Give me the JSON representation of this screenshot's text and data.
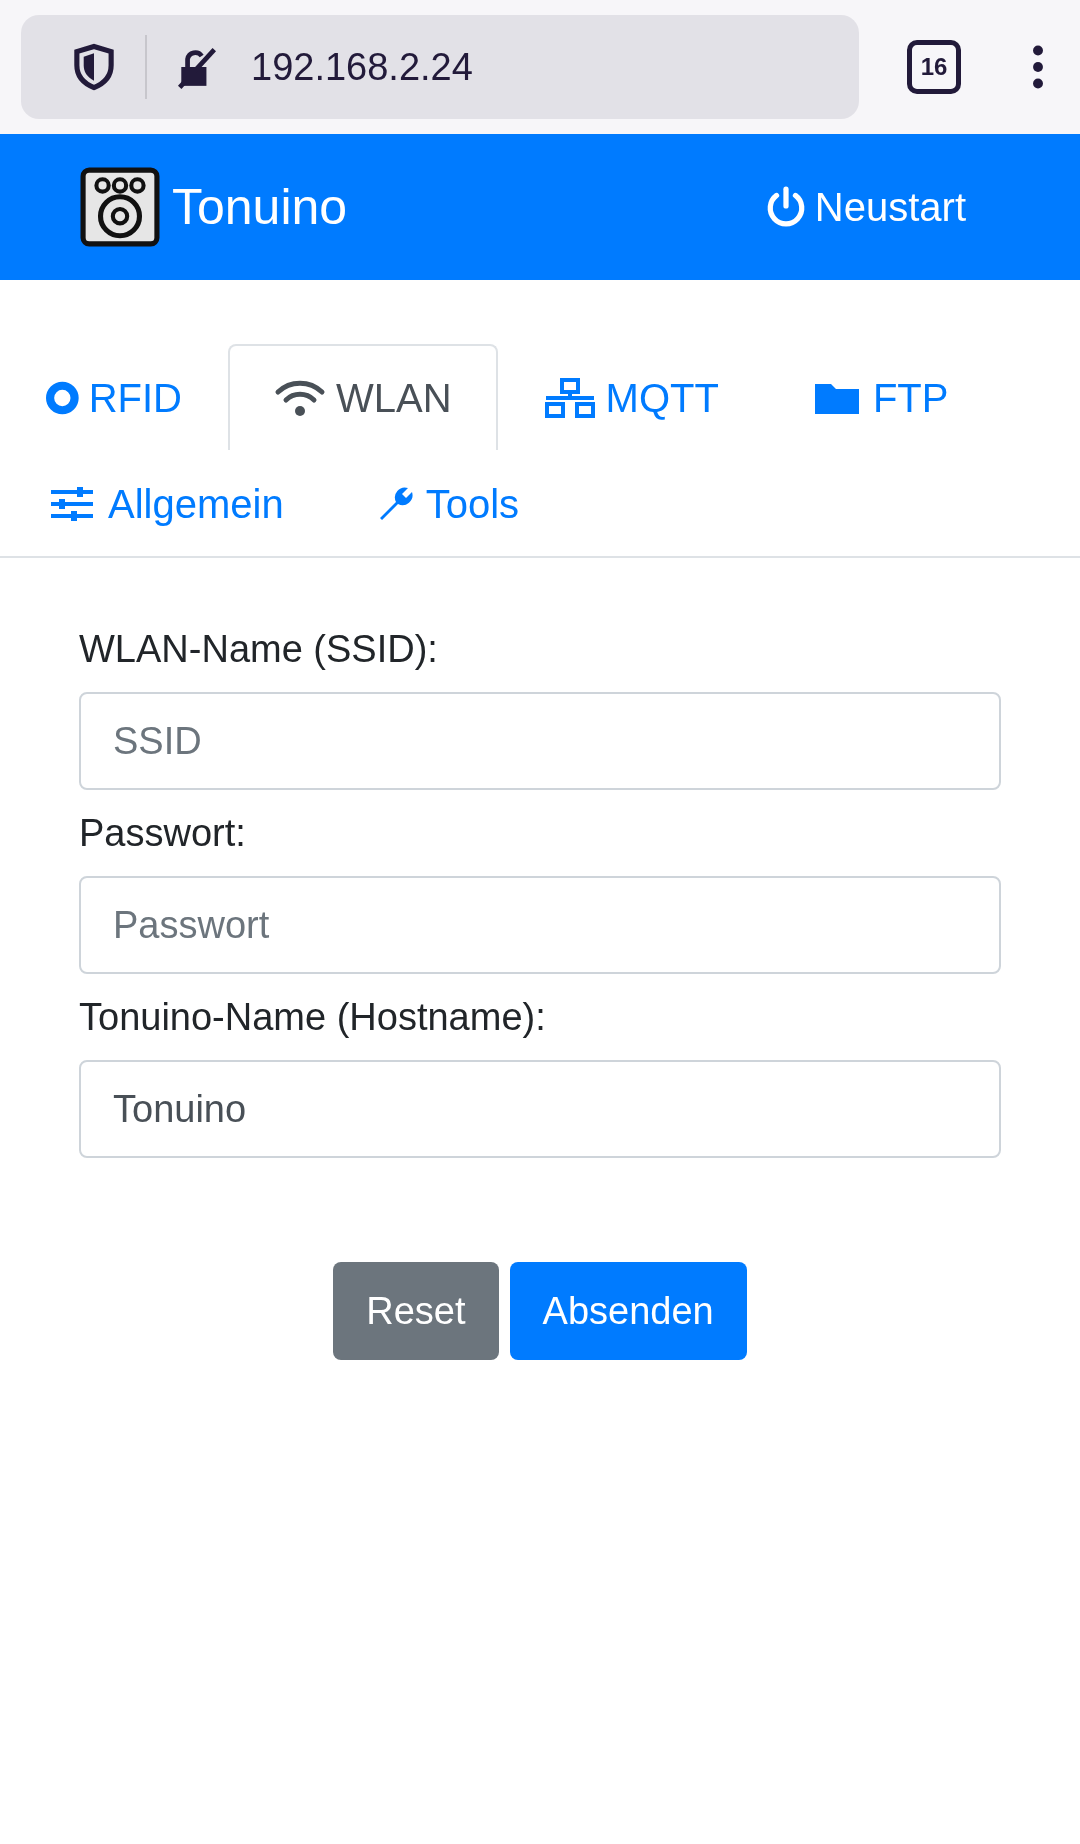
{
  "browser": {
    "url": "192.168.2.24",
    "tab_count": "16"
  },
  "navbar": {
    "brand": "Tonuino",
    "restart": "Neustart"
  },
  "tabs": [
    {
      "label": "RFID",
      "kind": "rfid",
      "selected": false
    },
    {
      "label": "WLAN",
      "kind": "wifi",
      "selected": true
    },
    {
      "label": "MQTT",
      "kind": "network",
      "selected": false
    },
    {
      "label": "FTP",
      "kind": "folder",
      "selected": false
    },
    {
      "label": "Allgemein",
      "kind": "sliders",
      "selected": false
    },
    {
      "label": "Tools",
      "kind": "wrench",
      "selected": false
    }
  ],
  "form": {
    "fields": [
      {
        "label": "WLAN-Name (SSID):",
        "placeholder": "SSID"
      },
      {
        "label": "Passwort:",
        "placeholder": "Passwort"
      },
      {
        "label": "Tonuino-Name (Hostname):",
        "value": "Tonuino"
      }
    ],
    "buttons": [
      {
        "label": "Reset",
        "kind": "secondary"
      },
      {
        "label": "Absenden",
        "kind": "primary"
      }
    ]
  }
}
